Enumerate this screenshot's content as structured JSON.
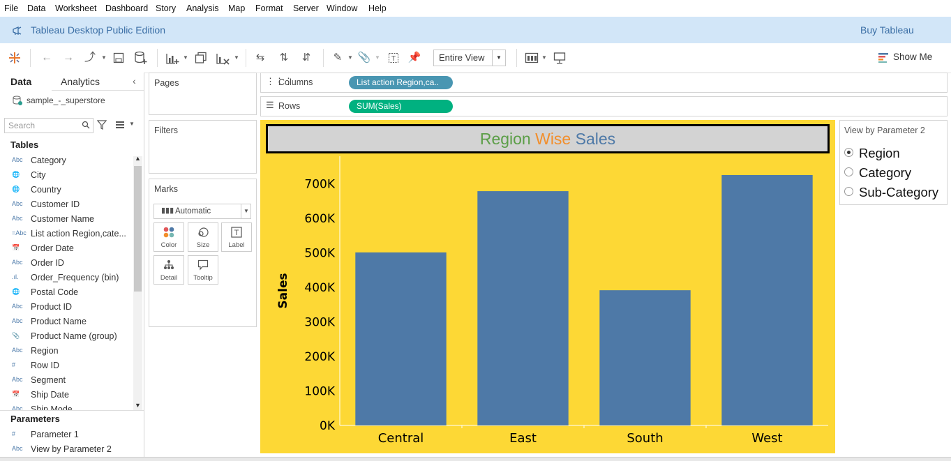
{
  "menu": [
    "File",
    "Data",
    "Worksheet",
    "Dashboard",
    "Story",
    "Analysis",
    "Map",
    "Format",
    "Server",
    "Window",
    "Help"
  ],
  "banner": {
    "title": "Tableau Desktop Public Edition",
    "buy": "Buy Tableau"
  },
  "toolbar": {
    "view_mode": "Entire View",
    "show_me": "Show Me"
  },
  "datapane": {
    "tab_data": "Data",
    "tab_analytics": "Analytics",
    "datasource": "sample_-_superstore",
    "search_placeholder": "Search",
    "tables_header": "Tables",
    "fields": [
      {
        "icon": "Abc",
        "label": "Category"
      },
      {
        "icon": "globe",
        "label": "City"
      },
      {
        "icon": "globe",
        "label": "Country"
      },
      {
        "icon": "Abc",
        "label": "Customer ID"
      },
      {
        "icon": "Abc",
        "label": "Customer Name"
      },
      {
        "icon": "=Abc",
        "label": "List action Region,cate..."
      },
      {
        "icon": "cal",
        "label": "Order Date"
      },
      {
        "icon": "Abc",
        "label": "Order ID"
      },
      {
        "icon": "bin",
        "label": "Order_Frequency (bin)"
      },
      {
        "icon": "globe",
        "label": "Postal Code"
      },
      {
        "icon": "Abc",
        "label": "Product ID"
      },
      {
        "icon": "Abc",
        "label": "Product Name"
      },
      {
        "icon": "clip",
        "label": "Product Name (group)"
      },
      {
        "icon": "Abc",
        "label": "Region"
      },
      {
        "icon": "#",
        "label": "Row ID"
      },
      {
        "icon": "Abc",
        "label": "Segment"
      },
      {
        "icon": "cal",
        "label": "Ship Date"
      },
      {
        "icon": "Abc",
        "label": "Ship Mode"
      }
    ],
    "parameters_header": "Parameters",
    "parameters": [
      {
        "icon": "#",
        "label": "Parameter 1"
      },
      {
        "icon": "Abc",
        "label": "View by Parameter 2"
      }
    ]
  },
  "cards": {
    "pages": "Pages",
    "filters": "Filters",
    "marks": "Marks",
    "mark_type": "Automatic",
    "mark_buttons": [
      "Color",
      "Size",
      "Label",
      "Detail",
      "Tooltip"
    ]
  },
  "shelves": {
    "columns_label": "Columns",
    "columns_pill": "List action Region,ca..",
    "rows_label": "Rows",
    "rows_pill": "SUM(Sales)"
  },
  "viz_title": {
    "w1": "Region",
    "w2": "Wise",
    "w3": "Sales",
    "c1": "#5b9e47",
    "c2": "#f28e2b",
    "c3": "#4e79a7"
  },
  "parameter_card": {
    "title": "View by Parameter 2",
    "options": [
      "Region",
      "Category",
      "Sub-Category"
    ],
    "selected": 0
  },
  "chart_data": {
    "type": "bar",
    "categories": [
      "Central",
      "East",
      "South",
      "West"
    ],
    "values": [
      501240,
      678781,
      391722,
      725458
    ],
    "ylabel": "Sales",
    "ylim": [
      0,
      780000
    ],
    "yticks": [
      "0K",
      "100K",
      "200K",
      "300K",
      "400K",
      "500K",
      "600K",
      "700K"
    ],
    "ytick_values": [
      0,
      100000,
      200000,
      300000,
      400000,
      500000,
      600000,
      700000
    ],
    "bar_color": "#4e79a7",
    "background": "#fdd835",
    "grid": false
  }
}
